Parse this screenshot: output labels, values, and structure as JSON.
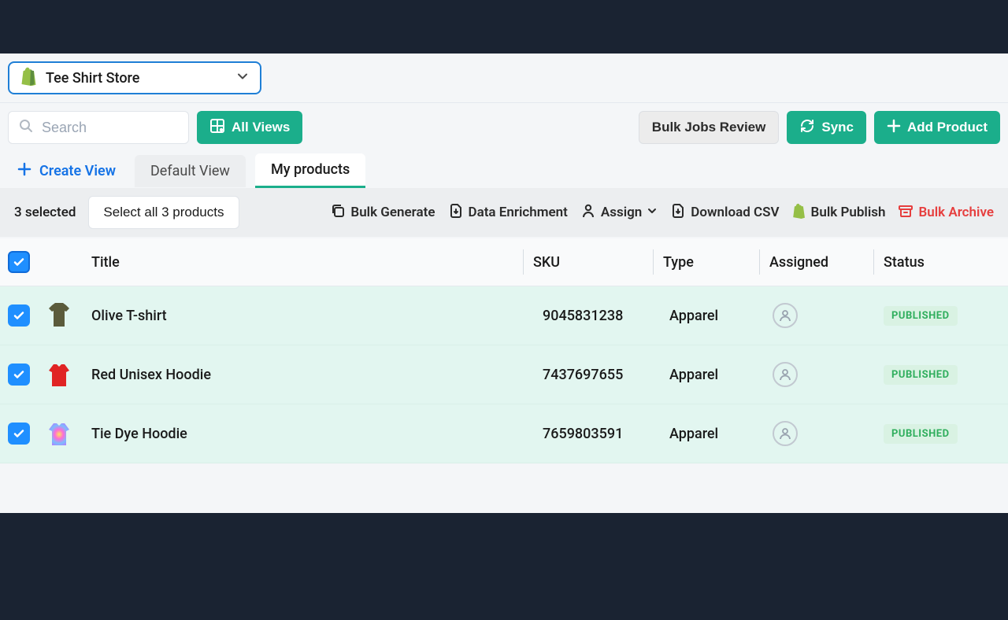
{
  "store": {
    "name": "Tee Shirt Store"
  },
  "search": {
    "placeholder": "Search"
  },
  "buttons": {
    "all_views": "All Views",
    "bulk_jobs": "Bulk Jobs Review",
    "sync": "Sync",
    "add_product": "Add Product"
  },
  "tabs": {
    "create_view": "Create View",
    "default_view": "Default View",
    "my_products": "My products"
  },
  "selection": {
    "count_label": "3 selected",
    "select_all": "Select all 3 products"
  },
  "actions": {
    "bulk_generate": "Bulk Generate",
    "data_enrichment": "Data Enrichment",
    "assign": "Assign",
    "download_csv": "Download CSV",
    "bulk_publish": "Bulk Publish",
    "bulk_archive": "Bulk Archive"
  },
  "columns": {
    "title": "Title",
    "sku": "SKU",
    "type": "Type",
    "assigned": "Assigned",
    "status": "Status"
  },
  "rows": [
    {
      "title": "Olive T-shirt",
      "sku": "9045831238",
      "type": "Apparel",
      "status": "PUBLISHED",
      "thumb_color": "#5b5b3b",
      "thumb_kind": "tshirt"
    },
    {
      "title": "Red Unisex Hoodie",
      "sku": "7437697655",
      "type": "Apparel",
      "status": "PUBLISHED",
      "thumb_color": "#e02424",
      "thumb_kind": "hoodie"
    },
    {
      "title": "Tie Dye Hoodie",
      "sku": "7659803591",
      "type": "Apparel",
      "status": "PUBLISHED",
      "thumb_color": "tiedye",
      "thumb_kind": "hoodie"
    }
  ]
}
